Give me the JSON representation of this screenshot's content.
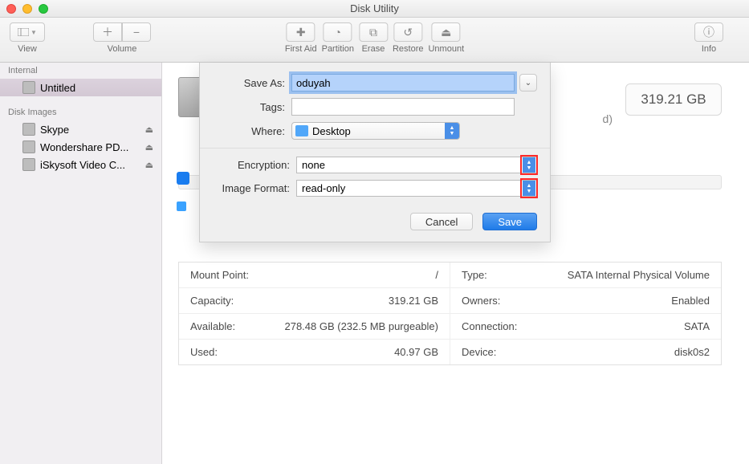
{
  "window": {
    "title": "Disk Utility"
  },
  "toolbar": {
    "view_label": "View",
    "volume_label": "Volume",
    "firstaid_label": "First Aid",
    "partition_label": "Partition",
    "erase_label": "Erase",
    "restore_label": "Restore",
    "unmount_label": "Unmount",
    "info_label": "Info"
  },
  "sidebar": {
    "internal_hdr": "Internal",
    "diskimg_hdr": "Disk Images",
    "internal": [
      {
        "name": "Untitled"
      }
    ],
    "images": [
      {
        "name": "Skype"
      },
      {
        "name": "Wondershare PD..."
      },
      {
        "name": "iSkysoft Video C..."
      }
    ]
  },
  "header": {
    "capacity": "319.21 GB",
    "sub_suffix": "d)"
  },
  "info": {
    "left": [
      {
        "k": "Mount Point:",
        "v": "/"
      },
      {
        "k": "Capacity:",
        "v": "319.21 GB"
      },
      {
        "k": "Available:",
        "v": "278.48 GB (232.5 MB purgeable)"
      },
      {
        "k": "Used:",
        "v": "40.97 GB"
      }
    ],
    "right": [
      {
        "k": "Type:",
        "v": "SATA Internal Physical Volume"
      },
      {
        "k": "Owners:",
        "v": "Enabled"
      },
      {
        "k": "Connection:",
        "v": "SATA"
      },
      {
        "k": "Device:",
        "v": "disk0s2"
      }
    ]
  },
  "sheet": {
    "saveas_label": "Save As:",
    "saveas_value": "oduyah",
    "tags_label": "Tags:",
    "where_label": "Where:",
    "where_value": "Desktop",
    "encryption_label": "Encryption:",
    "encryption_value": "none",
    "format_label": "Image Format:",
    "format_value": "read-only",
    "cancel": "Cancel",
    "save": "Save"
  }
}
